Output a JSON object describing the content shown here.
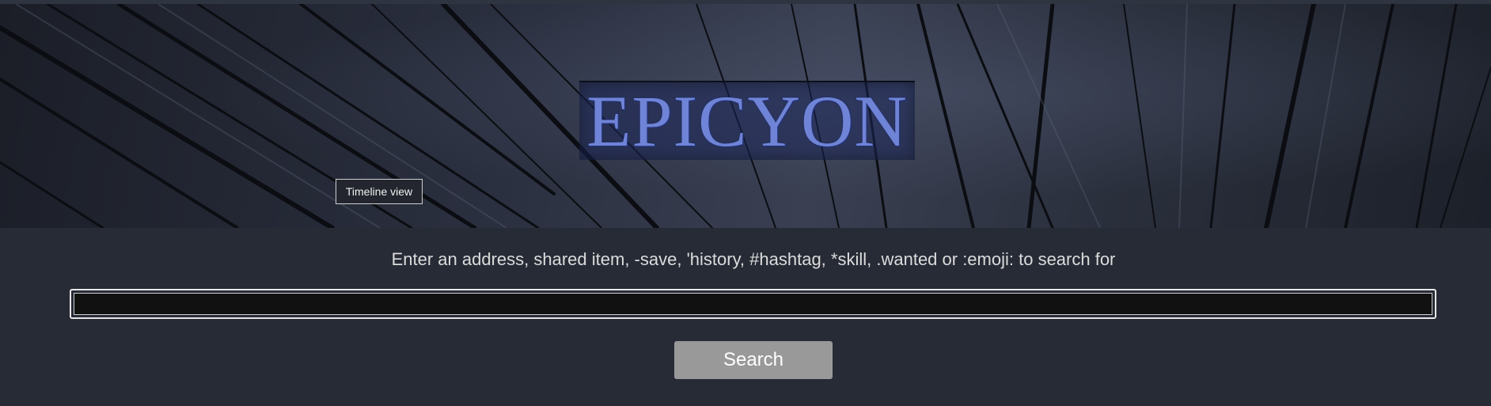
{
  "banner": {
    "logo_text": "EPICYON",
    "timeline_button_label": "Timeline view"
  },
  "search": {
    "prompt": "Enter an address, shared item, -save, 'history, #hashtag, *skill, .wanted or :emoji: to search for",
    "value": "",
    "placeholder": "",
    "button_label": "Search"
  },
  "colors": {
    "page_background": "#272b36",
    "logo_text": "#6f84d6",
    "search_button": "#999999",
    "input_background": "#111111"
  }
}
